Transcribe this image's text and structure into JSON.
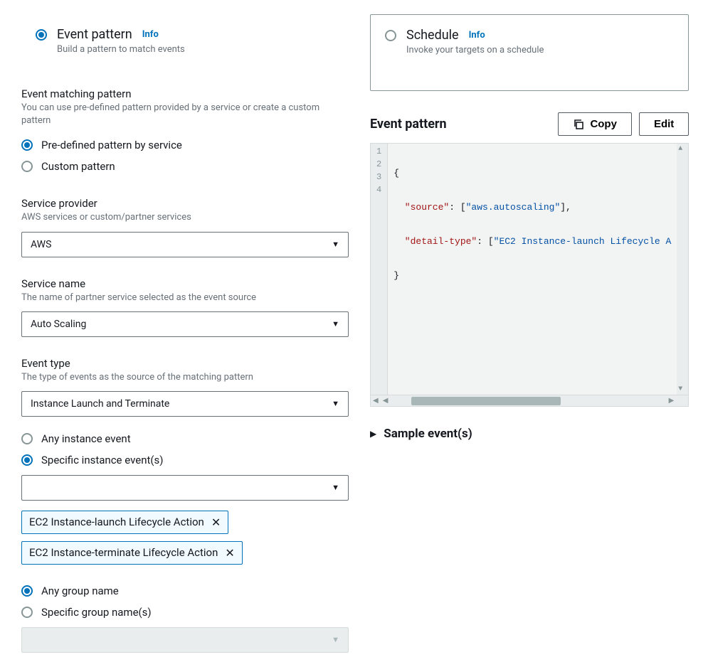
{
  "top": {
    "eventPattern": {
      "title": "Event pattern",
      "info": "Info",
      "subtitle": "Build a pattern to match events"
    },
    "schedule": {
      "title": "Schedule",
      "info": "Info",
      "subtitle": "Invoke your targets on a schedule"
    }
  },
  "matchingPattern": {
    "title": "Event matching pattern",
    "desc": "You can use pre-defined pattern provided by a service or create a custom pattern",
    "options": {
      "predefined": "Pre-defined pattern by service",
      "custom": "Custom pattern"
    }
  },
  "serviceProvider": {
    "title": "Service provider",
    "desc": "AWS services or custom/partner services",
    "value": "AWS"
  },
  "serviceName": {
    "title": "Service name",
    "desc": "The name of partner service selected as the event source",
    "value": "Auto Scaling"
  },
  "eventType": {
    "title": "Event type",
    "desc": "The type of events as the source of the matching pattern",
    "value": "Instance Launch and Terminate"
  },
  "instanceEvents": {
    "any": "Any instance event",
    "specific": "Specific instance event(s)"
  },
  "eventTags": [
    "EC2 Instance-launch Lifecycle Action",
    "EC2 Instance-terminate Lifecycle Action"
  ],
  "groupName": {
    "any": "Any group name",
    "specific": "Specific group name(s)"
  },
  "patternPanel": {
    "title": "Event pattern",
    "copy": "Copy",
    "edit": "Edit",
    "code": {
      "l1": "{",
      "l2a": "  \"source\"",
      "l2b": ": [",
      "l2c": "\"aws.autoscaling\"",
      "l2d": "],",
      "l3a": "  \"detail-type\"",
      "l3b": ": [",
      "l3c": "\"EC2 Instance-launch Lifecycle A",
      "l4": "}"
    },
    "lineNumbers": [
      "1",
      "2",
      "3",
      "4"
    ]
  },
  "sampleEvents": "Sample event(s)"
}
